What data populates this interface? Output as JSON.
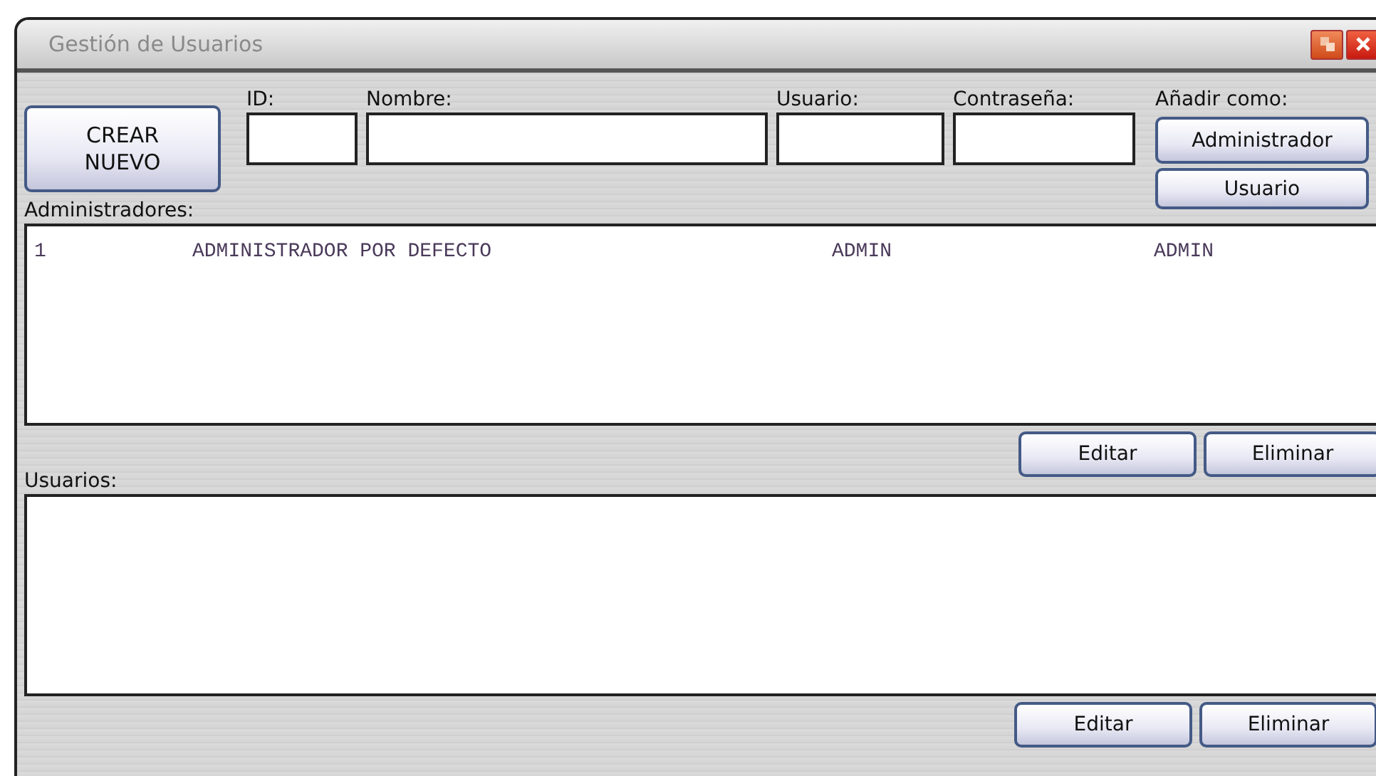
{
  "window": {
    "title": "Gestión de Usuarios"
  },
  "create_button": {
    "label": "CREAR\nNUEVO"
  },
  "fields": [
    {
      "label": "ID:"
    },
    {
      "label": "Nombre:"
    },
    {
      "label": "Usuario:"
    },
    {
      "label": "Contraseña:"
    }
  ],
  "add_as": {
    "label": "Añadir como:",
    "buttons": [
      "Administrador",
      "Usuario"
    ]
  },
  "lists": [
    {
      "label": "Administradores:",
      "rows": [
        [
          "1",
          "ADMINISTRADOR POR DEFECTO",
          "ADMIN",
          "ADMIN"
        ]
      ],
      "buttons": [
        "Editar",
        "Eliminar"
      ]
    },
    {
      "label": "Usuarios:",
      "buttons": [
        "Editar",
        "Eliminar"
      ]
    }
  ]
}
